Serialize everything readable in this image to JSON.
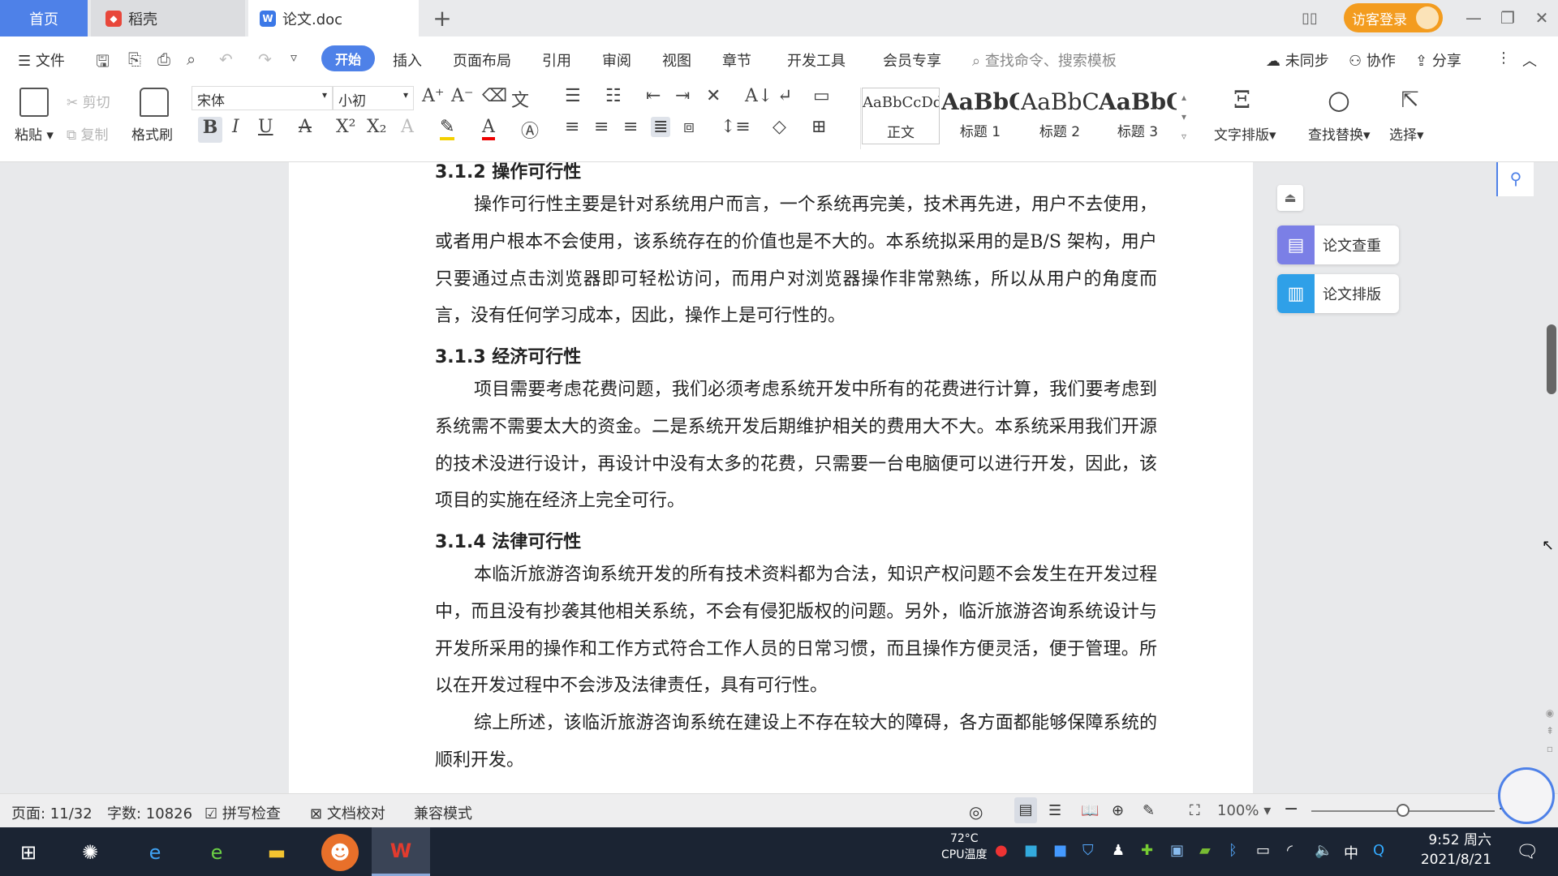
{
  "tabs": {
    "home": "首页",
    "daoke": "稻壳",
    "doc": "论文.doc",
    "add": "+"
  },
  "titlebar": {
    "guest_login": "访客登录"
  },
  "menu": {
    "file": "文件",
    "items": [
      "开始",
      "插入",
      "页面布局",
      "引用",
      "审阅",
      "视图",
      "章节",
      "开发工具",
      "会员专享"
    ],
    "search_placeholder": "查找命令、搜索模板",
    "sync": "未同步",
    "collab": "协作",
    "share": "分享"
  },
  "ribbon": {
    "paste": "粘贴",
    "cut": "剪切",
    "copy": "复制",
    "format_painter": "格式刷",
    "font_name": "宋体",
    "font_size": "小初",
    "styles": [
      {
        "sample": "AaBbCcDd",
        "label": "正文"
      },
      {
        "sample": "AaBbC",
        "label": "标题 1"
      },
      {
        "sample": "AaBbC",
        "label": "标题 2"
      },
      {
        "sample": "AaBbC",
        "label": "标题 3"
      }
    ],
    "text_layout": "文字排版",
    "find_replace": "查找替换",
    "select": "选择"
  },
  "document": {
    "h312": "3.1.2  操作可行性",
    "p1": "操作可行性主要是针对系统用户而言，一个系统再完美，技术再先进，用户不去使用，或者用户根本不会使用，该系统存在的价值也是不大的。本系统拟采用的是B/S 架构，用户只要通过点击浏览器即可轻松访问，而用户对浏览器操作非常熟练，所以从用户的角度而言，没有任何学习成本，因此，操作上是可行性的。",
    "h313": "3.1.3  经济可行性",
    "p2": "项目需要考虑花费问题，我们必须考虑系统开发中所有的花费进行计算，我们要考虑到系统需不需要太大的资金。二是系统开发后期维护相关的费用大不大。本系统采用我们开源的技术没进行设计，再设计中没有太多的花费，只需要一台电脑便可以进行开发，因此，该项目的实施在经济上完全可行。",
    "h314": "3.1.4  法律可行性",
    "p3": "本临沂旅游咨询系统开发的所有技术资料都为合法，知识产权问题不会发生在开发过程中，而且没有抄袭其他相关系统，不会有侵犯版权的问题。另外，临沂旅游咨询系统设计与开发所采用的操作和工作方式符合工作人员的日常习惯，而且操作方便灵活，便于管理。所以在开发过程中不会涉及法律责任，具有可行性。",
    "p4": "综上所述，该临沂旅游咨询系统在建设上不存在较大的障碍，各方面都能够保障系统的顺利开发。"
  },
  "sidepanel": {
    "check": "论文查重",
    "layout": "论文排版"
  },
  "status": {
    "page": "页面: 11/32",
    "words": "字数: 10826",
    "spell": "拼写检查",
    "proof": "文档校对",
    "compat": "兼容模式",
    "zoom": "100%",
    "zoom_level": 0.5
  },
  "taskbar": {
    "temp": "72°C",
    "temp_label": "CPU温度",
    "ime": "中",
    "time": "9:52 周六",
    "date": "2021/8/21"
  },
  "colors": {
    "accent": "#4e81e8",
    "guest": "#f39c1f",
    "taskbar": "#1b2433"
  }
}
